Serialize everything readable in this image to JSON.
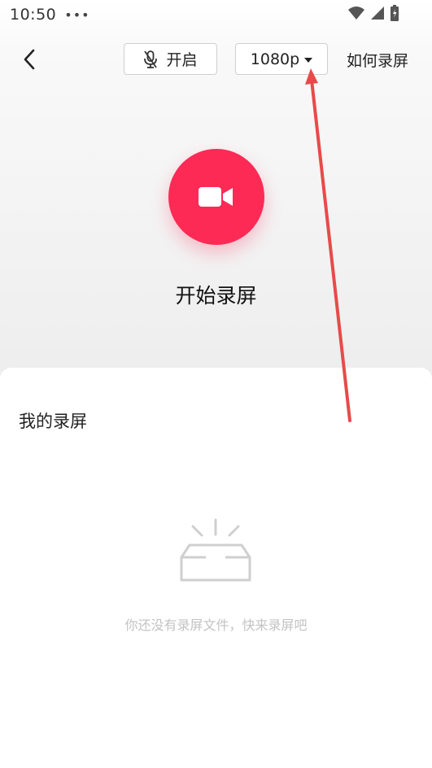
{
  "status_bar": {
    "time": "10:50",
    "dots": "•••",
    "icons": [
      "wifi-icon",
      "signal-icon",
      "battery-icon"
    ]
  },
  "toolbar": {
    "back_icon": "chevron-left-icon",
    "mic_icon": "mic-off-icon",
    "mic_label": "开启",
    "resolution_label": "1080p",
    "resolution_icon": "caret-down-icon",
    "howto_label": "如何录屏"
  },
  "recorder": {
    "button_icon": "video-camera-icon",
    "label": "开始录屏",
    "accent_color": "#fc2a55"
  },
  "my_recordings": {
    "title": "我的录屏",
    "empty_icon": "empty-box-icon",
    "empty_text": "你还没有录屏文件，快来录屏吧"
  },
  "annotation": {
    "color": "#e84a4a",
    "icon": "red-arrow-annotation"
  }
}
